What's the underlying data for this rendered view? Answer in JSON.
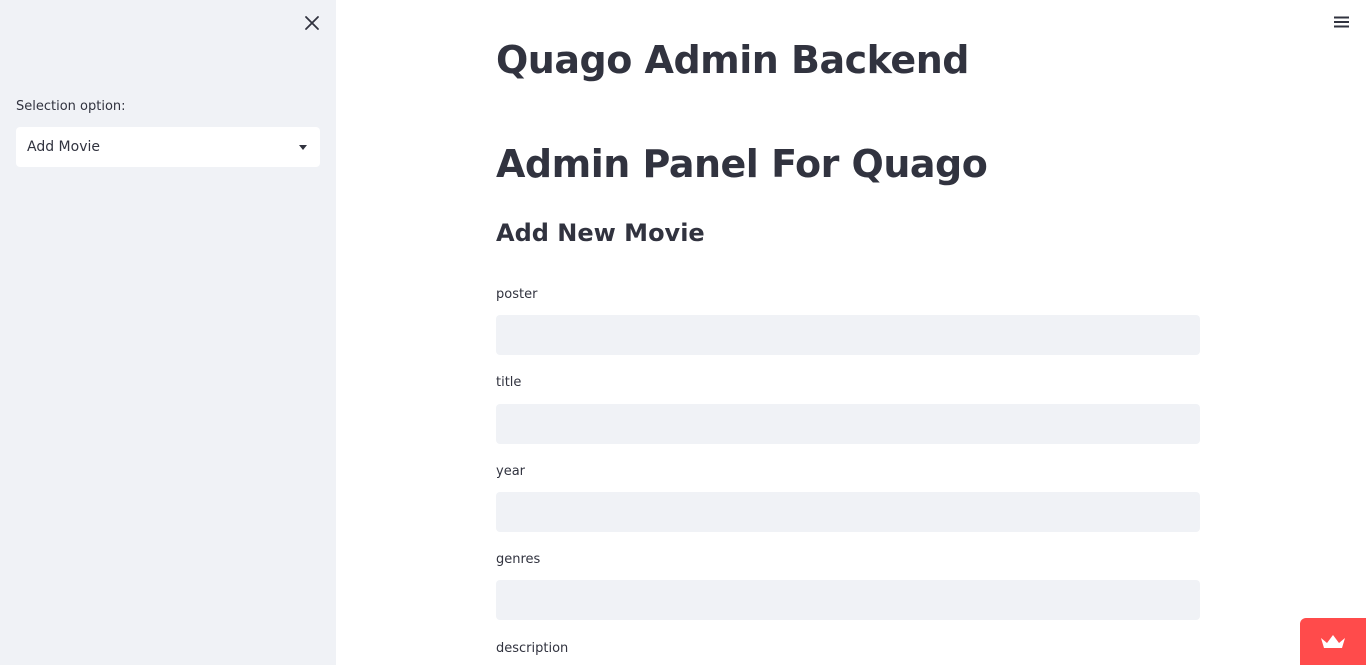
{
  "sidebar": {
    "close_icon": "close-icon",
    "select_label": "Selection option:",
    "select_value": "Add Movie",
    "caret_icon": "caret-down-icon"
  },
  "header": {
    "menu_icon": "hamburger-menu-icon"
  },
  "main": {
    "title": "Quago Admin Backend",
    "panel_title": "Admin Panel For Quago",
    "section_title": "Add New Movie",
    "fields": [
      {
        "label": "poster",
        "value": ""
      },
      {
        "label": "title",
        "value": ""
      },
      {
        "label": "year",
        "value": ""
      },
      {
        "label": "genres",
        "value": ""
      },
      {
        "label": "description",
        "value": ""
      }
    ]
  },
  "badge": {
    "icon": "crown-icon",
    "color": "#ff4b4b"
  },
  "colors": {
    "sidebar_bg": "#f0f2f6",
    "text": "#31333f",
    "input_bg": "#f0f2f6",
    "accent": "#ff4b4b"
  }
}
